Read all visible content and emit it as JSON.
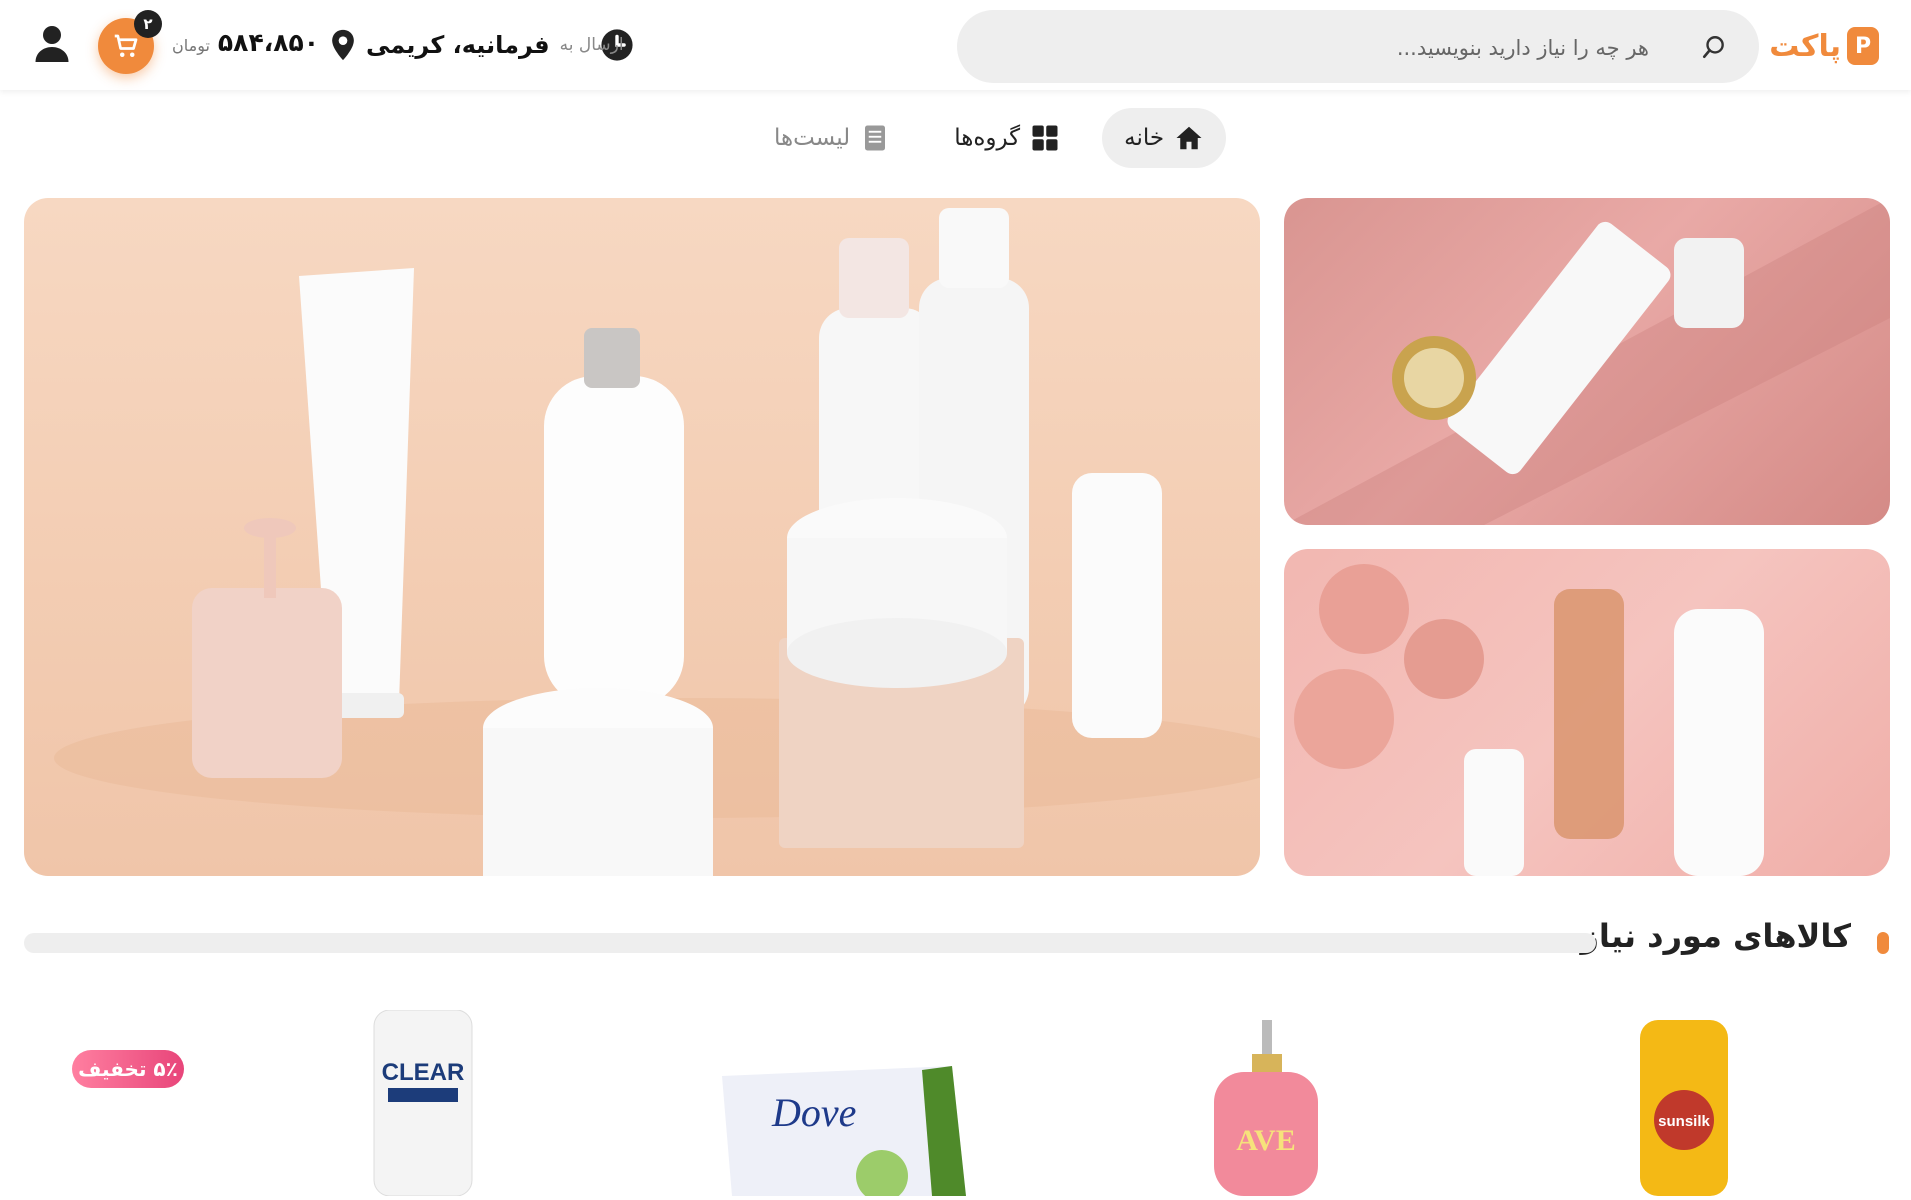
{
  "header": {
    "logo_text": "پاکت",
    "search_placeholder": "هر چه را نیاز دارید بنویسید...",
    "deliver_label": "ارسال به",
    "deliver_city": "فرمانیه، کریمی",
    "balance_amount": "۵۸۴،۸۵۰",
    "balance_unit": "تومان",
    "cart_count": "۲"
  },
  "nav": {
    "tabs": [
      {
        "label": "خانه",
        "icon": "home-icon"
      },
      {
        "label": "گروه‌ها",
        "icon": "grid-icon"
      },
      {
        "label": "لیست‌ها",
        "icon": "list-icon"
      }
    ]
  },
  "section": {
    "title": "کالاهای مورد نیاز"
  },
  "products": {
    "discount_badge": "۵٪ تخفیف",
    "brands": [
      "CLEAR",
      "Dove",
      "AVE",
      "sunsilk"
    ]
  },
  "colors": {
    "accent": "#f08a3c",
    "discount": "#e8457a",
    "surface": "#eeeeee"
  }
}
